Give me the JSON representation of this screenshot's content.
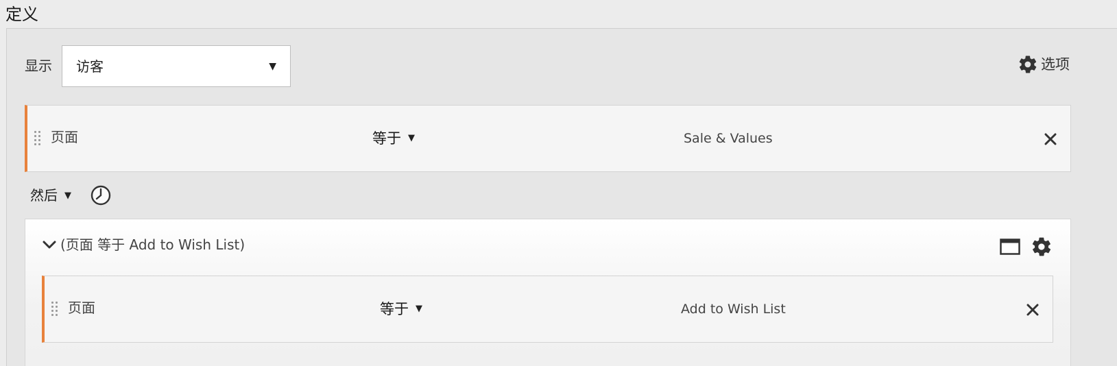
{
  "section": {
    "title": "定义"
  },
  "show": {
    "label": "显示",
    "selected": "访客"
  },
  "options": {
    "label": "选项",
    "icon": "gear-icon"
  },
  "rules": [
    {
      "dimension": "页面",
      "operator": "等于",
      "value": "Sale & Values"
    }
  ],
  "sequence": {
    "label": "然后",
    "icon": "clock-icon"
  },
  "container": {
    "title": "(页面 等于 Add to Wish List)",
    "icons": [
      "container-window-icon",
      "gear-icon"
    ],
    "rules": [
      {
        "dimension": "页面",
        "operator": "等于",
        "value": "Add to Wish List"
      }
    ]
  },
  "colors": {
    "accent": "#e8823c",
    "panel_bg": "#e6e6e6",
    "row_bg": "#f5f5f5"
  }
}
